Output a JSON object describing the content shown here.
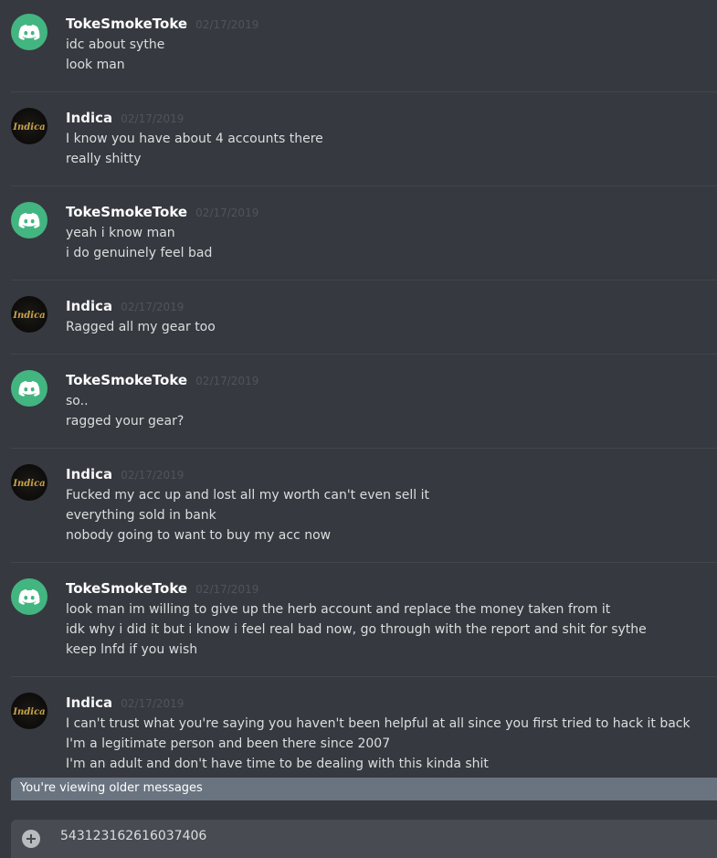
{
  "messages": [
    {
      "author": "TokeSmokeToke",
      "timestamp": "02/17/2019",
      "avatar": "discord-default-icon",
      "lines": [
        "idc about sythe",
        "look man"
      ]
    },
    {
      "author": "Indica",
      "timestamp": "02/17/2019",
      "avatar": "indica-avatar",
      "lines": [
        "I know you have about 4 accounts there",
        "really shitty"
      ]
    },
    {
      "author": "TokeSmokeToke",
      "timestamp": "02/17/2019",
      "avatar": "discord-default-icon",
      "lines": [
        "yeah i know man",
        "i do genuinely feel bad"
      ]
    },
    {
      "author": "Indica",
      "timestamp": "02/17/2019",
      "avatar": "indica-avatar",
      "lines": [
        "Ragged all my gear too"
      ]
    },
    {
      "author": "TokeSmokeToke",
      "timestamp": "02/17/2019",
      "avatar": "discord-default-icon",
      "lines": [
        "so..",
        "ragged your gear?"
      ]
    },
    {
      "author": "Indica",
      "timestamp": "02/17/2019",
      "avatar": "indica-avatar",
      "lines": [
        "Fucked my acc up and lost all my worth can't even sell it",
        "everything sold in bank",
        "nobody going to want to buy my acc now"
      ]
    },
    {
      "author": "TokeSmokeToke",
      "timestamp": "02/17/2019",
      "avatar": "discord-default-icon",
      "lines": [
        "look man im willing to give up the herb account and replace the money taken from it",
        "idk why i did it but  i know i feel real bad now, go through with the report and shit for sythe",
        "keep lnfd if you wish"
      ]
    },
    {
      "author": "Indica",
      "timestamp": "02/17/2019",
      "avatar": "indica-avatar",
      "lines": [
        "I can't trust what you're saying you haven't been helpful at all since you first tried to hack it back",
        "I'm a legitimate person and been there since 2007",
        "I'm an adult and don't have time to be dealing with this kinda shit"
      ]
    }
  ],
  "indica_avatar_text": "Indica",
  "older_messages_bar": "You're viewing older messages",
  "composer": {
    "value": "543123162616037406",
    "add_icon": "plus-circle-icon"
  },
  "colors": {
    "background": "#36393f",
    "discord_avatar": "#43b581",
    "timestamp": "#4f545c",
    "older_bar": "#6a7480",
    "composer": "#484c52"
  }
}
